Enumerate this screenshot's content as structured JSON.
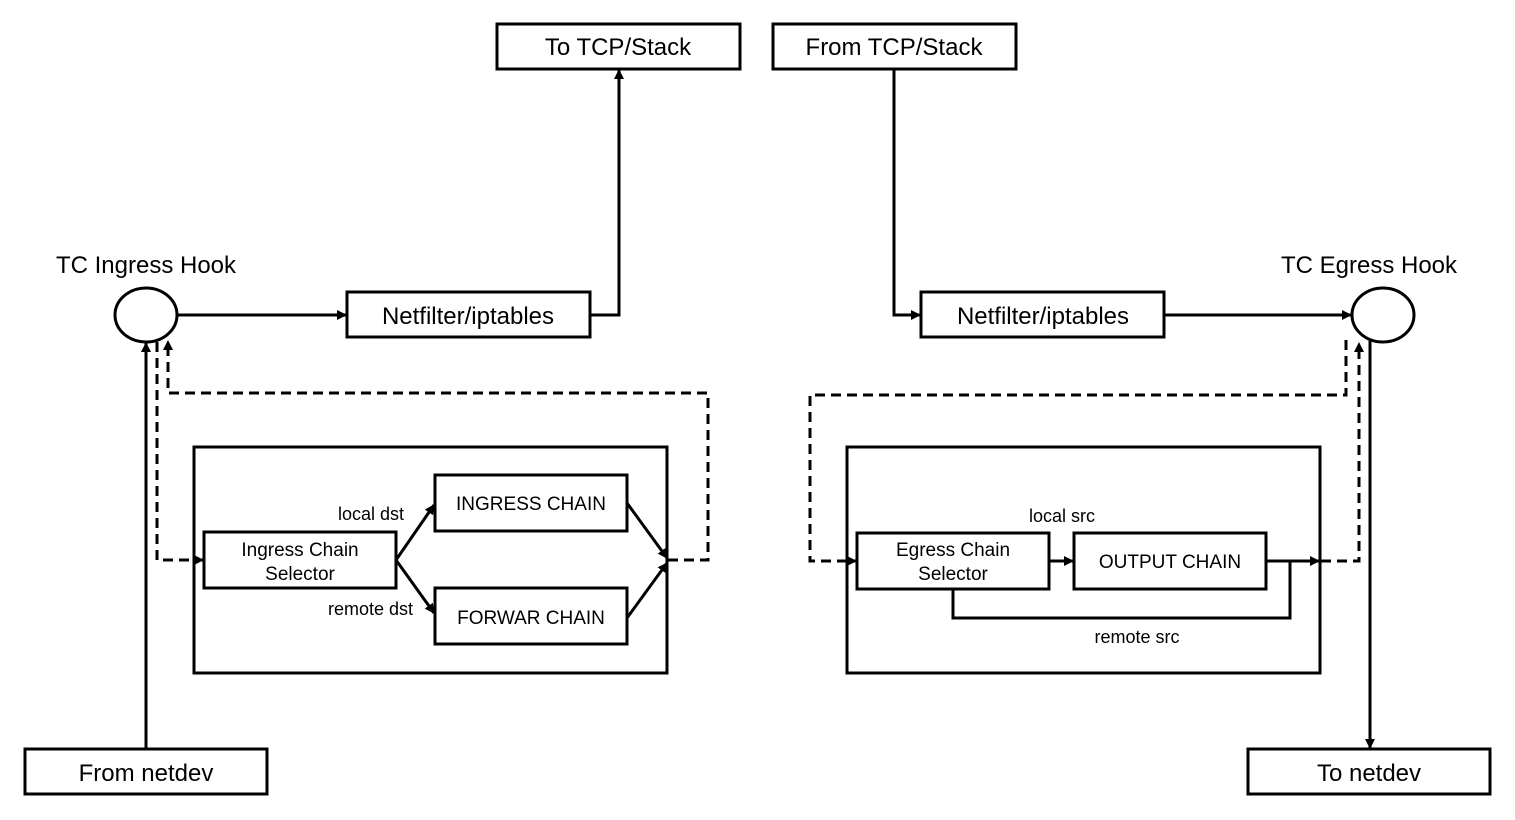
{
  "nodes": {
    "to_tcp_stack": "To TCP/Stack",
    "from_tcp_stack": "From TCP/Stack",
    "tc_ingress_hook": "TC Ingress Hook",
    "tc_egress_hook": "TC Egress Hook",
    "netfilter_ingress": "Netfilter/iptables",
    "netfilter_egress": "Netfilter/iptables",
    "from_netdev": "From netdev",
    "to_netdev": "To netdev",
    "ingress_selector_line1": "Ingress Chain",
    "ingress_selector_line2": "Selector",
    "ingress_chain": "INGRESS CHAIN",
    "forward_chain": "FORWAR CHAIN",
    "egress_selector_line1": "Egress Chain",
    "egress_selector_line2": "Selector",
    "output_chain": "OUTPUT CHAIN"
  },
  "edge_labels": {
    "local_dst": "local dst",
    "remote_dst": "remote dst",
    "local_src": "local src",
    "remote_src": "remote src"
  }
}
